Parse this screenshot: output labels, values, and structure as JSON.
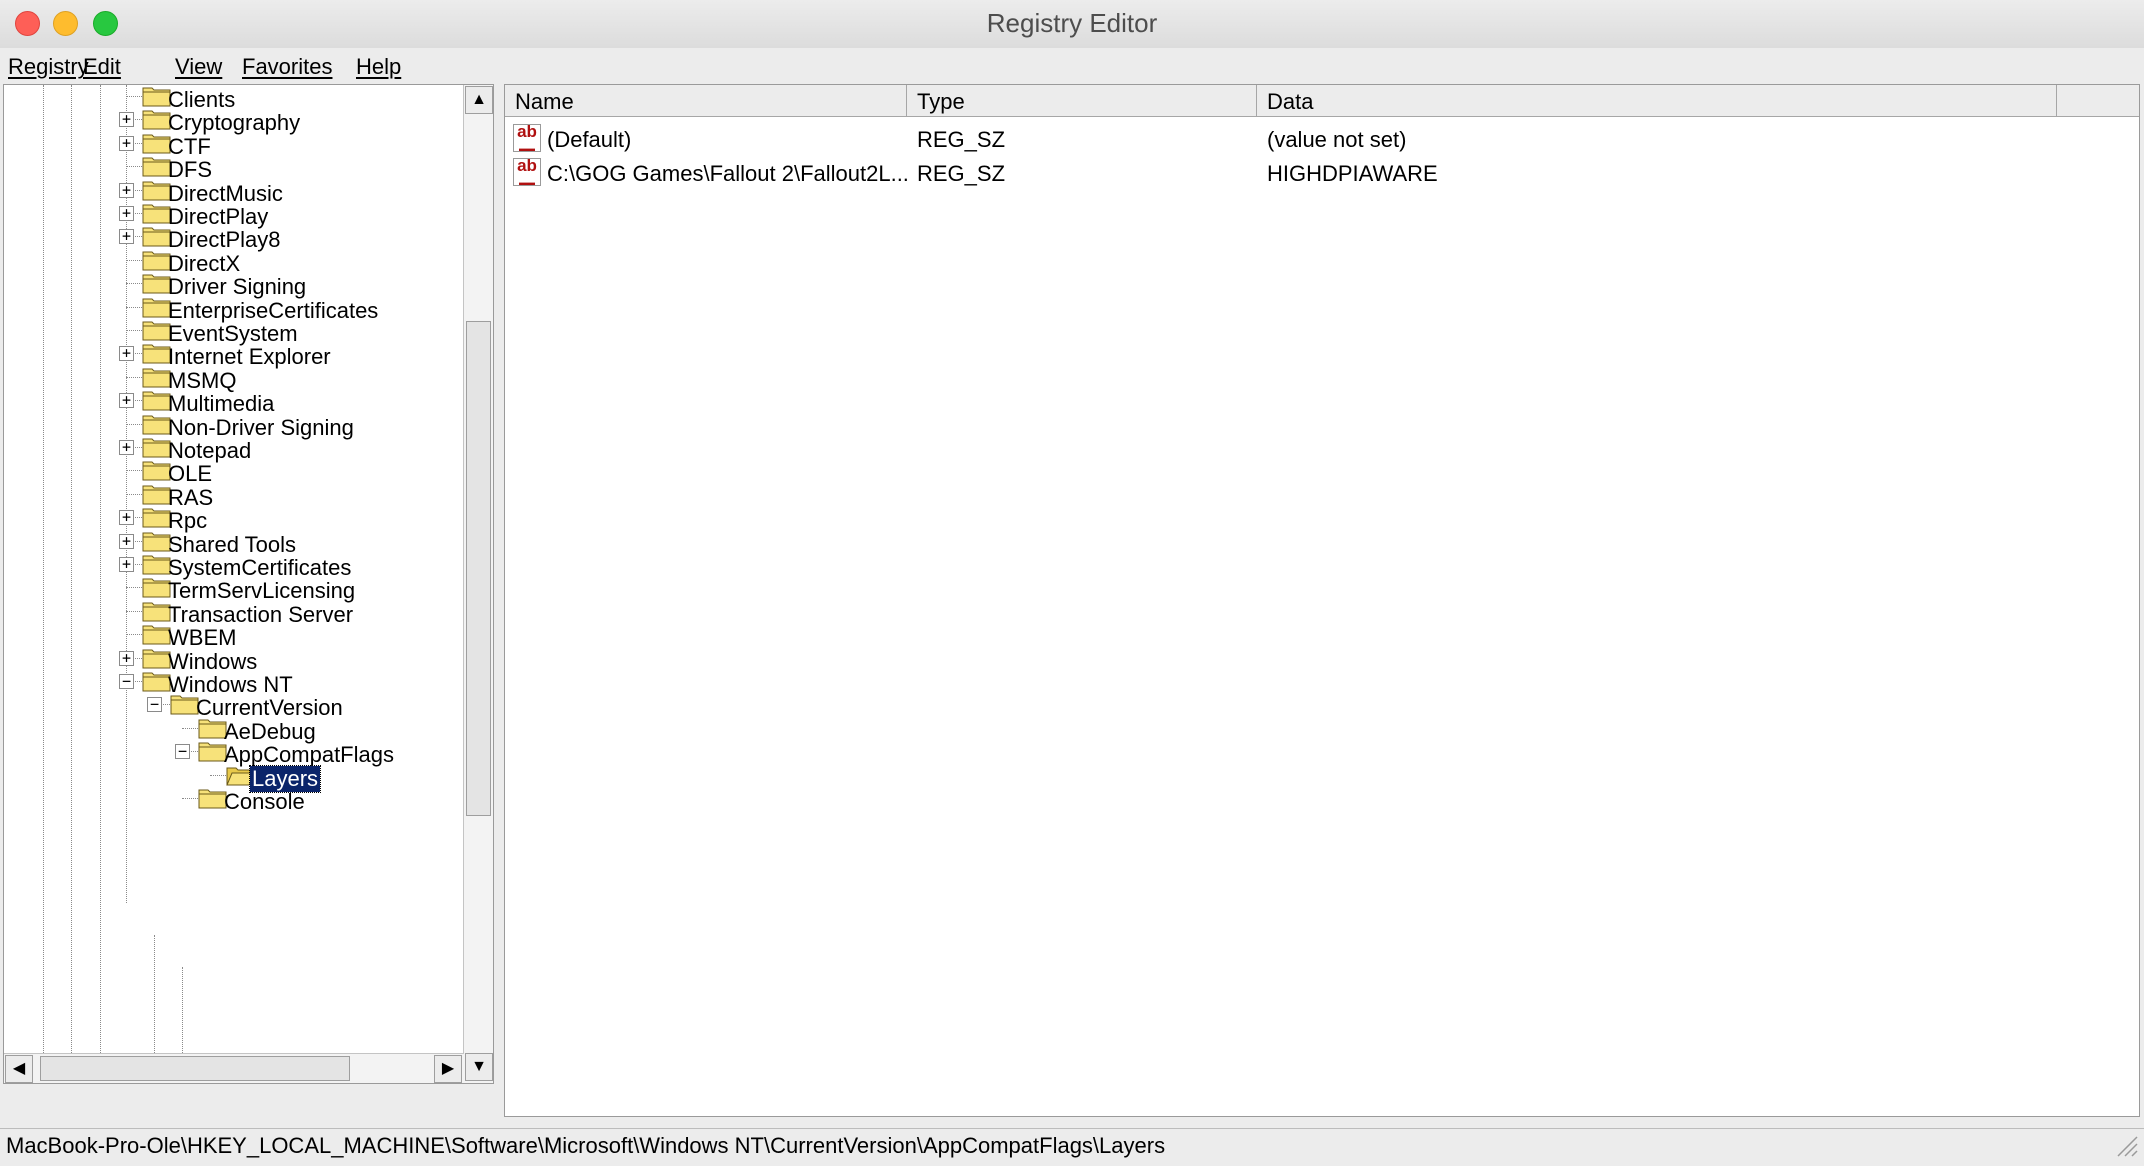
{
  "window": {
    "title": "Registry Editor"
  },
  "menu": [
    "Registry",
    "Edit",
    "View",
    "Favorites",
    "Help"
  ],
  "tree": {
    "items": [
      {
        "label": "Clients",
        "expandable": false
      },
      {
        "label": "Cryptography",
        "expandable": true
      },
      {
        "label": "CTF",
        "expandable": true
      },
      {
        "label": "DFS",
        "expandable": false
      },
      {
        "label": "DirectMusic",
        "expandable": true
      },
      {
        "label": "DirectPlay",
        "expandable": true
      },
      {
        "label": "DirectPlay8",
        "expandable": true
      },
      {
        "label": "DirectX",
        "expandable": false
      },
      {
        "label": "Driver Signing",
        "expandable": false
      },
      {
        "label": "EnterpriseCertificates",
        "expandable": false
      },
      {
        "label": "EventSystem",
        "expandable": false
      },
      {
        "label": "Internet Explorer",
        "expandable": true
      },
      {
        "label": "MSMQ",
        "expandable": false
      },
      {
        "label": "Multimedia",
        "expandable": true
      },
      {
        "label": "Non-Driver Signing",
        "expandable": false
      },
      {
        "label": "Notepad",
        "expandable": true
      },
      {
        "label": "OLE",
        "expandable": false
      },
      {
        "label": "RAS",
        "expandable": false
      },
      {
        "label": "Rpc",
        "expandable": true
      },
      {
        "label": "Shared Tools",
        "expandable": true
      },
      {
        "label": "SystemCertificates",
        "expandable": true
      },
      {
        "label": "TermServLicensing",
        "expandable": false
      },
      {
        "label": "Transaction Server",
        "expandable": false
      },
      {
        "label": "WBEM",
        "expandable": false
      },
      {
        "label": "Windows",
        "expandable": true
      },
      {
        "label": "Windows NT",
        "expandable": true,
        "expanded": true
      },
      {
        "label": "CurrentVersion",
        "expandable": true,
        "expanded": true,
        "depth": 1
      },
      {
        "label": "AeDebug",
        "expandable": false,
        "depth": 2
      },
      {
        "label": "AppCompatFlags",
        "expandable": true,
        "expanded": true,
        "depth": 2
      },
      {
        "label": "Layers",
        "expandable": false,
        "depth": 3,
        "selected": true,
        "open": true
      },
      {
        "label": "Console",
        "expandable": false,
        "depth": 2
      }
    ]
  },
  "list": {
    "columns": [
      "Name",
      "Type",
      "Data"
    ],
    "rows": [
      {
        "name": "(Default)",
        "type": "REG_SZ",
        "data": "(value not set)",
        "icon": "string-value-icon"
      },
      {
        "name": "C:\\GOG Games\\Fallout 2\\Fallout2L...",
        "type": "REG_SZ",
        "data": "HIGHDPIAWARE",
        "icon": "string-value-icon"
      }
    ]
  },
  "status": {
    "path": "MacBook-Pro-Ole\\HKEY_LOCAL_MACHINE\\Software\\Microsoft\\Windows NT\\CurrentVersion\\AppCompatFlags\\Layers"
  },
  "colors": {
    "selection": "#0a246a",
    "folder": "#f7e27a",
    "icon_text": "#b01010"
  }
}
